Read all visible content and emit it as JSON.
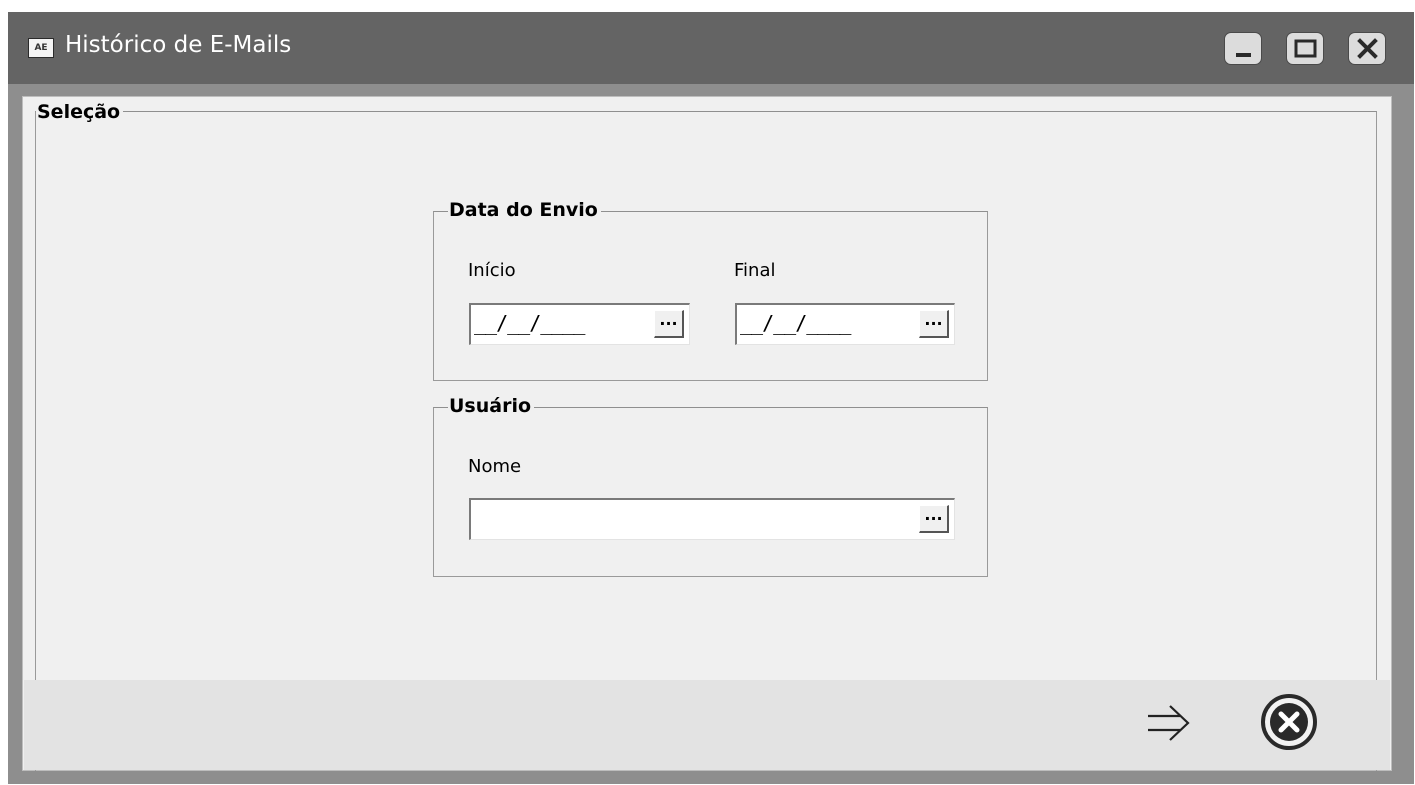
{
  "window": {
    "title": "Histórico de E-Mails",
    "app_icon_text": "AE"
  },
  "selection": {
    "legend": "Seleção",
    "date_group": {
      "legend": "Data do Envio",
      "start_label": "Início",
      "start_value": "__/__/____",
      "end_label": "Final",
      "end_value": "__/__/____"
    },
    "user_group": {
      "legend": "Usuário",
      "name_label": "Nome",
      "name_value": ""
    },
    "ellipsis_label": "..."
  },
  "footer": {
    "confirm_icon": "arrow-right-icon",
    "cancel_icon": "close-circle-icon"
  }
}
